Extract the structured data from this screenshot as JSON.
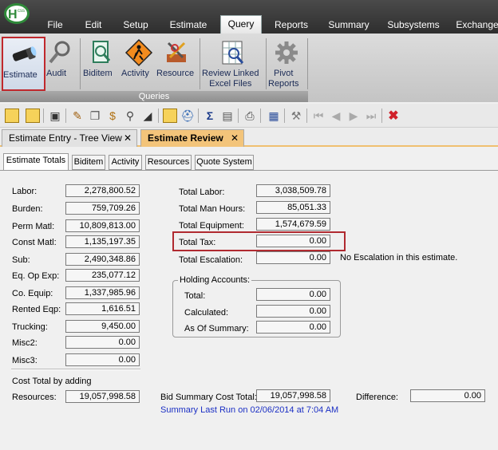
{
  "menu": {
    "items": [
      "File",
      "Edit",
      "Setup",
      "Estimate",
      "Query",
      "Reports",
      "Summary",
      "Subsystems",
      "Exchange"
    ],
    "active": "Query"
  },
  "ribbon": {
    "buttons": [
      {
        "label": "Estimate",
        "icon": "flashlight-icon"
      },
      {
        "label": "Audit",
        "icon": "magnifier-icon"
      },
      {
        "label": "Biditem",
        "icon": "biditem-icon"
      },
      {
        "label": "Activity",
        "icon": "worker-sign-icon"
      },
      {
        "label": "Resource",
        "icon": "tools-icon"
      },
      {
        "label": "Review Linked\nExcel Files",
        "icon": "excel-magnifier-icon"
      },
      {
        "label": "Pivot\nReports",
        "icon": "gear-icon"
      }
    ],
    "group_label": "Queries"
  },
  "doc_tabs": [
    {
      "label": "Estimate Entry - Tree View",
      "close": "✕"
    },
    {
      "label": "Estimate Review",
      "close": "✕"
    }
  ],
  "inner_tabs": [
    "Estimate Totals",
    "Biditem",
    "Activity",
    "Resources",
    "Quote System"
  ],
  "left_fields": [
    {
      "label": "Labor:",
      "value": "2,278,800.52"
    },
    {
      "label": "Burden:",
      "value": "759,709.26"
    },
    {
      "label": "Perm Matl:",
      "value": "10,809,813.00"
    },
    {
      "label": "Const Matl:",
      "value": "1,135,197.35"
    },
    {
      "label": "Sub:",
      "value": "2,490,348.86"
    },
    {
      "label": "Eq. Op Exp:",
      "value": "235,077.12"
    },
    {
      "label": "Co. Equip:",
      "value": "1,337,985.96"
    },
    {
      "label": "Rented Eqp:",
      "value": "1,616.51"
    },
    {
      "label": "Trucking:",
      "value": "9,450.00"
    },
    {
      "label": "Misc2:",
      "value": "0.00"
    },
    {
      "label": "Misc3:",
      "value": "0.00"
    }
  ],
  "cost_total": {
    "line1": "Cost Total by adding",
    "line2": "Resources:",
    "value": "19,057,998.58"
  },
  "right_fields": [
    {
      "label": "Total Labor:",
      "value": "3,038,509.78"
    },
    {
      "label": "Total Man Hours:",
      "value": "85,051.33"
    },
    {
      "label": "Total Equipment:",
      "value": "1,574,679.59"
    },
    {
      "label": "Total Tax:",
      "value": "0.00"
    },
    {
      "label": "Total Escalation:",
      "value": "0.00"
    }
  ],
  "escalation_note": "No Escalation in this estimate.",
  "holding": {
    "title": "Holding Accounts:",
    "fields": [
      {
        "label": "Total:",
        "value": "0.00"
      },
      {
        "label": "Calculated:",
        "value": "0.00"
      },
      {
        "label": "As Of Summary:",
        "value": "0.00"
      }
    ]
  },
  "bid_summary": {
    "label": "Bid Summary Cost Total:",
    "value": "19,057,998.58"
  },
  "difference": {
    "label": "Difference:",
    "value": "0.00"
  },
  "summary_run": "Summary Last Run on 02/06/2014 at 7:04 AM",
  "colors": {
    "highlight": "#b02a30",
    "link": "#1b2fc4",
    "active_tab": "#f3c47a"
  }
}
